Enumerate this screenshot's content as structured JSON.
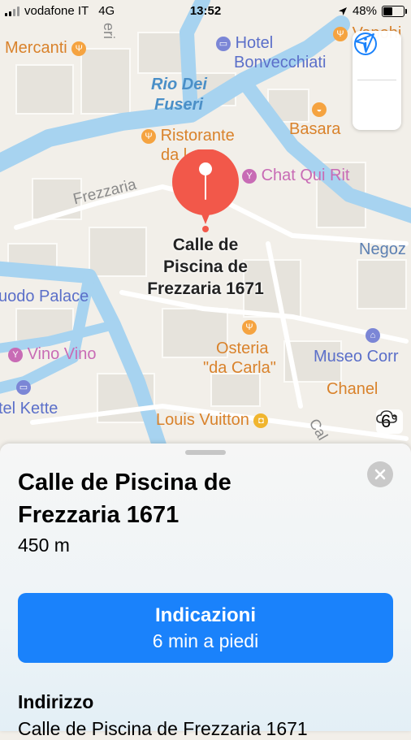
{
  "status_bar": {
    "carrier": "vodafone IT",
    "network": "4G",
    "time": "13:52",
    "battery_percent": "48%",
    "battery_level": 0.48
  },
  "map": {
    "labels": {
      "mercanti": "Mercanti",
      "eri": "eri",
      "hotel": "Hotel",
      "bonvecchiati": "Bonvecchiati",
      "vapoh": "Vapohi",
      "rio_dei": "Rio Dei",
      "fuseri": "Fuseri",
      "ristorante": "Ristorante",
      "da": "da l",
      "basara": "Basara",
      "frezzaria": "Frezzaria",
      "chat_qui_rit": "Chat Qui Rit",
      "negoz": "Negoz",
      "palace": "uodo Palace",
      "vino_vino": "Vino Vino",
      "osteria": "Osteria",
      "da_carla": "\"da Carla\"",
      "museo_corr": "Museo Corr",
      "chanel": "Chanel",
      "kette": "tel Kette",
      "louis_vuitton": "Louis Vuitton",
      "cal": "Cal"
    },
    "pin_title_lines": [
      "Calle de",
      "Piscina de",
      "Frezzaria 1671"
    ],
    "weather": {
      "icon": "cloud-icon",
      "temp": "6°"
    },
    "colors": {
      "water": "#a7d3f0",
      "land": "#f2efe9",
      "pin": "#f2584a"
    }
  },
  "sheet": {
    "title_line1": "Calle de Piscina de",
    "title_line2": "Frezzaria 1671",
    "distance": "450 m",
    "directions_label": "Indicazioni",
    "directions_sub": "6 min a piedi",
    "section_heading": "Indirizzo",
    "address": "Calle de Piscina de Frezzaria 1671",
    "accent": "#1a82fb"
  }
}
